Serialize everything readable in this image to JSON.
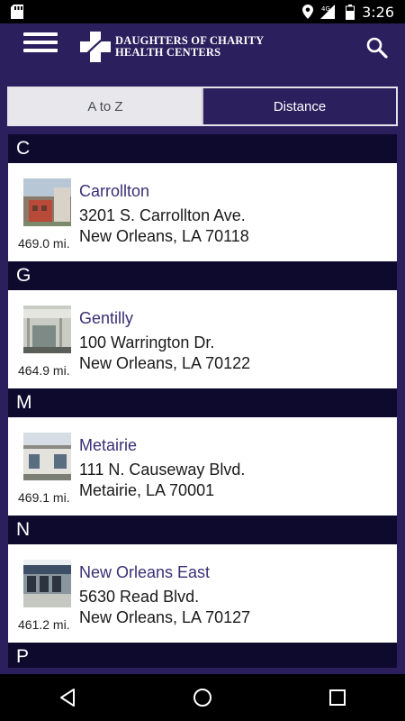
{
  "status_bar": {
    "network": "4G",
    "time": "3:26"
  },
  "header": {
    "logo_line1": "DAUGHTERS OF CHARITY",
    "logo_line2": "HEALTH CENTERS",
    "menu_icon": "hamburger-menu-icon",
    "search_icon": "search-icon"
  },
  "tabs": {
    "a_to_z": "A to Z",
    "distance": "Distance",
    "active": "Distance"
  },
  "sections": [
    {
      "letter": "C",
      "name": "Carrollton",
      "street": "3201 S. Carrollton Ave.",
      "city": "New Orleans, LA 70118",
      "distance": "469.0 mi."
    },
    {
      "letter": "G",
      "name": "Gentilly",
      "street": "100 Warrington Dr.",
      "city": "New Orleans, LA 70122",
      "distance": "464.9 mi."
    },
    {
      "letter": "M",
      "name": "Metairie",
      "street": "111 N. Causeway Blvd.",
      "city": "Metairie, LA 70001",
      "distance": "469.1 mi."
    },
    {
      "letter": "N",
      "name": "New Orleans East",
      "street": "5630 Read Blvd.",
      "city": "New Orleans, LA 70127",
      "distance": "461.2 mi."
    },
    {
      "letter": "P"
    }
  ],
  "colors": {
    "brand": "#2b1f5e",
    "section_header": "#0d0a2e",
    "link": "#3a2f75"
  }
}
